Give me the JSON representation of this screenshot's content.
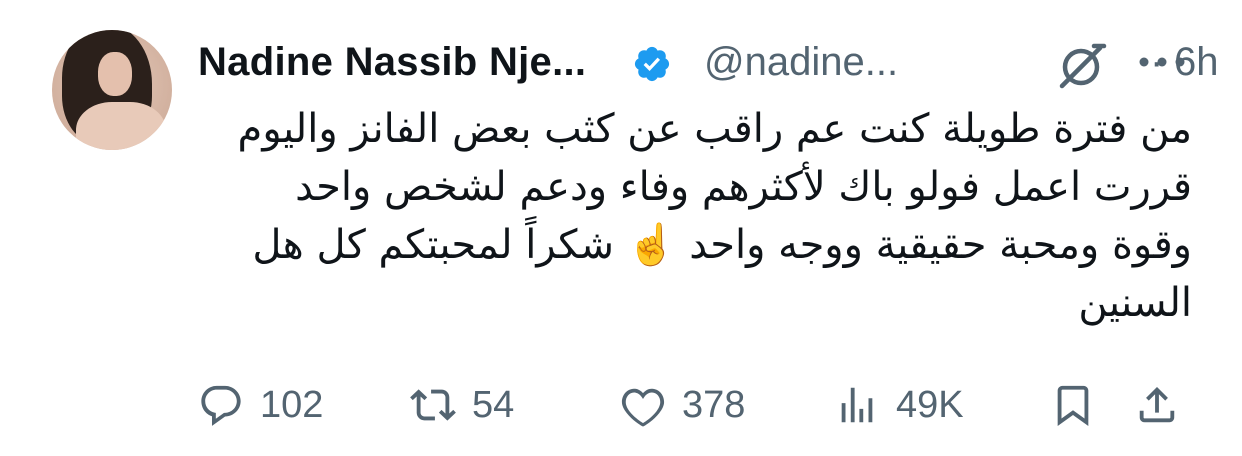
{
  "author": {
    "name": "Nadine Nassib Nje...",
    "handle": "@nadine...",
    "separator": "·",
    "time": "6h",
    "verified": true
  },
  "tweet": {
    "lines": [
      "من فترة طويلة كنت عم راقب عن كثب بعض الفانز واليوم",
      "قررت اعمل فولو باك لأكثرهم وفاء ودعم لشخص واحد",
      "وقوة ومحبة حقيقية ووجه واحد ☝️ شكراً لمحبتكم كل هل",
      "السنين"
    ]
  },
  "actions": {
    "replies": "102",
    "retweets": "54",
    "likes": "378",
    "views": "49K"
  },
  "icons": {
    "reply": "reply-icon",
    "retweet": "retweet-icon",
    "like": "heart-icon",
    "views": "views-icon",
    "bookmark": "bookmark-icon",
    "share": "share-icon",
    "grok": "grok-icon",
    "more": "more-icon",
    "verified": "verified-badge-icon"
  },
  "colors": {
    "text": "#0f1419",
    "secondary": "#536471",
    "verified_blue": "#1d9bf0"
  }
}
